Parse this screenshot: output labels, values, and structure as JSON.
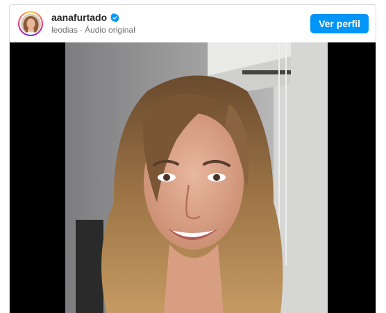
{
  "post": {
    "username": "aanafurtado",
    "verified": true,
    "music_owner": "leodias",
    "separator": "·",
    "audio_label": "Áudio original",
    "view_profile_label": "Ver perfil",
    "icons": {
      "verified": "verified-badge-icon",
      "avatar": "profile-avatar"
    },
    "colors": {
      "button": "#0095f6",
      "verified": "#0095f6",
      "username": "#262626",
      "subtext": "#737373"
    }
  }
}
